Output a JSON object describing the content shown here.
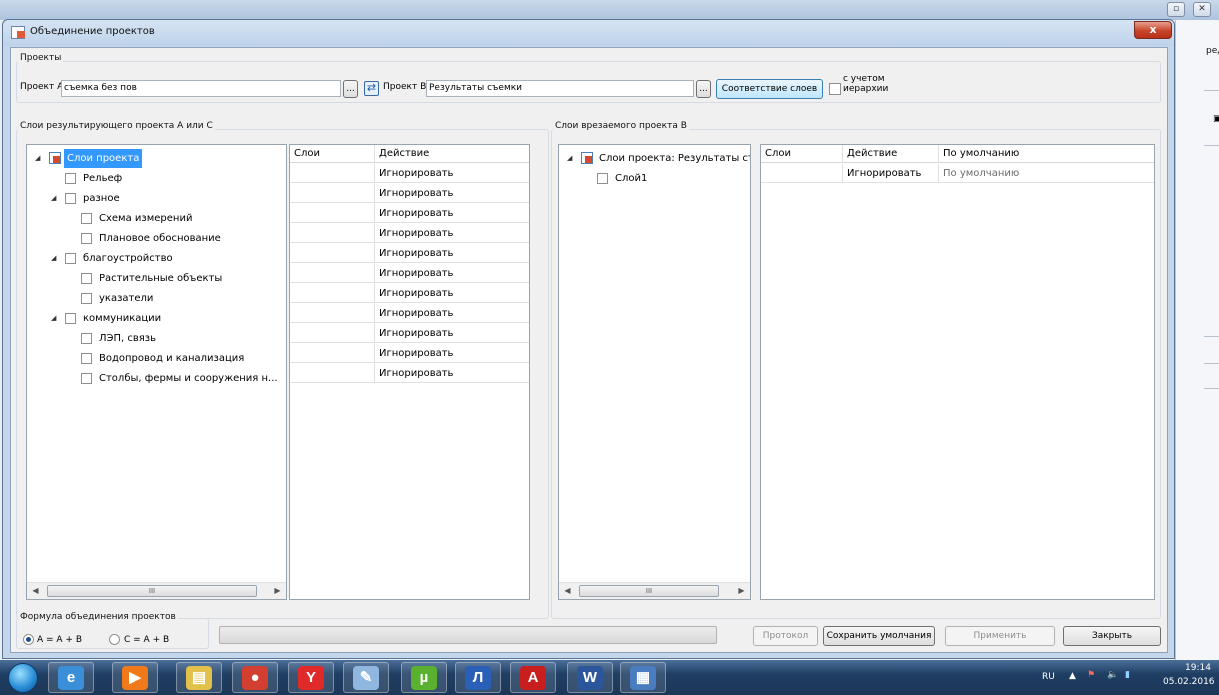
{
  "background_window": {
    "title": "",
    "fragment_text": "реда,",
    "fragment_icon": "window-restore-icon"
  },
  "dialog": {
    "title": "Объединение проектов",
    "close_glyph": "x"
  },
  "projects": {
    "group_label": "Проекты",
    "project_a_label": "Проект А",
    "project_a_value": "съемка без пов",
    "browse_label": "...",
    "project_b_label": "Проект В",
    "project_b_value": "Результаты съемки",
    "match_layers_button": "Соответствие слоев",
    "hierarchy_checkbox_label": "с учетом\nиерархии",
    "hierarchy_checked": false
  },
  "left_panel": {
    "group_label": "Слои результирующего проекта А или С",
    "tree": [
      {
        "label": "Слои проекта",
        "level": 0,
        "expandable": true,
        "root": true,
        "selected": true
      },
      {
        "label": "Рельеф",
        "level": 1,
        "expandable": false
      },
      {
        "label": "разное",
        "level": 1,
        "expandable": true
      },
      {
        "label": "Схема измерений",
        "level": 2,
        "expandable": false
      },
      {
        "label": "Плановое обоснование",
        "level": 2,
        "expandable": false
      },
      {
        "label": "благоустройство",
        "level": 1,
        "expandable": true
      },
      {
        "label": "Растительные объекты",
        "level": 2,
        "expandable": false
      },
      {
        "label": "указатели",
        "level": 2,
        "expandable": false
      },
      {
        "label": "коммуникации",
        "level": 1,
        "expandable": true
      },
      {
        "label": "ЛЭП, связь",
        "level": 2,
        "expandable": false
      },
      {
        "label": "Водопровод и канализация",
        "level": 2,
        "expandable": false
      },
      {
        "label": "Столбы, фермы и сооружения н...",
        "level": 2,
        "expandable": false
      }
    ],
    "grid_headers": [
      "Слои",
      "Действие"
    ],
    "grid_rows": [
      [
        "",
        "Игнорировать"
      ],
      [
        "",
        "Игнорировать"
      ],
      [
        "",
        "Игнорировать"
      ],
      [
        "",
        "Игнорировать"
      ],
      [
        "",
        "Игнорировать"
      ],
      [
        "",
        "Игнорировать"
      ],
      [
        "",
        "Игнорировать"
      ],
      [
        "",
        "Игнорировать"
      ],
      [
        "",
        "Игнорировать"
      ],
      [
        "",
        "Игнорировать"
      ],
      [
        "",
        "Игнорировать"
      ]
    ],
    "scroll_thumb_glyph": "III"
  },
  "right_panel": {
    "group_label": "Слои врезаемого проекта В",
    "tree": [
      {
        "label": "Слои проекта: Результаты съ...",
        "level": 0,
        "expandable": true,
        "root": true
      },
      {
        "label": "Слой1",
        "level": 1,
        "expandable": false
      }
    ],
    "grid_headers": [
      "Слои",
      "Действие",
      "По умолчанию"
    ],
    "grid_rows": [
      [
        "",
        "Игнорировать",
        "По умолчанию"
      ]
    ],
    "scroll_thumb_glyph": "III"
  },
  "formula": {
    "group_label": "Формула объединения проектов",
    "options": [
      {
        "label": "А = А + В",
        "checked": true
      },
      {
        "label": "С = А + В",
        "checked": false
      }
    ]
  },
  "footer_buttons": {
    "protocol": "Протокол",
    "save_defaults": "Сохранить умолчания",
    "apply": "Применить",
    "close": "Закрыть"
  },
  "taskbar": {
    "apps": [
      {
        "name": "internet-explorer",
        "glyph": "e",
        "color": "#3a8fd8"
      },
      {
        "name": "media-player",
        "glyph": "▶",
        "color": "#f07a1a"
      },
      {
        "name": "file-explorer",
        "glyph": "▤",
        "color": "#e2c14a"
      },
      {
        "name": "chrome",
        "glyph": "●",
        "color": "#d23f31"
      },
      {
        "name": "yandex-browser",
        "glyph": "Y",
        "color": "#e02a2a"
      },
      {
        "name": "paint",
        "glyph": "✎",
        "color": "#8fb7e0"
      },
      {
        "name": "utorrent",
        "glyph": "µ",
        "color": "#59b12f"
      },
      {
        "name": "app-l",
        "glyph": "Л",
        "color": "#2a5fb8"
      },
      {
        "name": "acrobat-reader",
        "glyph": "A",
        "color": "#c81e1e"
      },
      {
        "name": "word",
        "glyph": "W",
        "color": "#2b579a"
      },
      {
        "name": "app-window",
        "glyph": "▦",
        "color": "#4a7cc0"
      }
    ],
    "language": "RU",
    "time": "19:14",
    "date": "05.02.2016"
  }
}
